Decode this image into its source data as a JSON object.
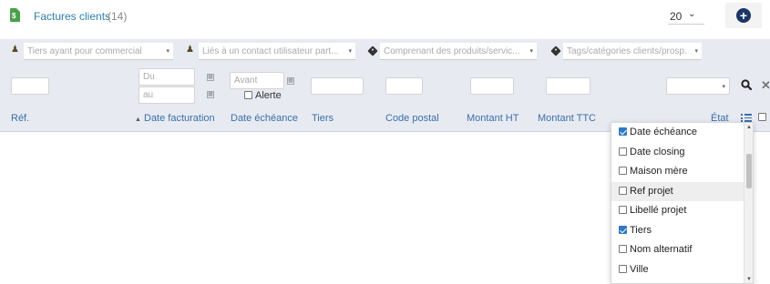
{
  "header": {
    "title": "Factures clients",
    "count": "(14)",
    "limit": "20",
    "limit_caret": "⌄"
  },
  "filters": {
    "commercial": {
      "placeholder": "Tiers ayant pour commercial",
      "caret": "▾"
    },
    "contact": {
      "placeholder": "Liés à un contact utilisateur part...",
      "caret": "▾"
    },
    "produits": {
      "placeholder": "Comprenant des produits/servic...",
      "caret": "▾"
    },
    "tags": {
      "placeholder": "Tags/catégories clients/prosp.",
      "caret": "▾"
    },
    "date_from_placeholder": "Du",
    "date_to_placeholder": "au",
    "echeance_placeholder": "Avant",
    "alerte_label": "Alerte",
    "etat_caret": "▾"
  },
  "columns": {
    "ref": "Réf.",
    "date_facturation": "Date facturation",
    "sort_indicator": "▲",
    "date_echeance": "Date échéance",
    "tiers": "Tiers",
    "code_postal": "Code postal",
    "montant_ht": "Montant HT",
    "montant_ttc": "Montant TTC",
    "etat": "État"
  },
  "column_picker": {
    "items": [
      {
        "label": "Date échéance",
        "checked": true
      },
      {
        "label": "Date closing",
        "checked": false
      },
      {
        "label": "Maison mère",
        "checked": false
      },
      {
        "label": "Ref projet",
        "checked": false,
        "highlighted": true
      },
      {
        "label": "Libellé projet",
        "checked": false
      },
      {
        "label": "Tiers",
        "checked": true
      },
      {
        "label": "Nom alternatif",
        "checked": false
      },
      {
        "label": "Ville",
        "checked": false
      }
    ],
    "scroll_up": "▲",
    "scroll_down": "▼"
  },
  "icons": {
    "doc": "$",
    "add": "+",
    "clear": "✕",
    "calendar": "▦"
  },
  "colors": {
    "title": "#2d7ea8",
    "accent_dark": "#1b3566",
    "filter_band": "#e8eaf2",
    "column_header": "#3a6fa8",
    "checked": "#3178c6",
    "doc_icon": "#4aa04a"
  }
}
